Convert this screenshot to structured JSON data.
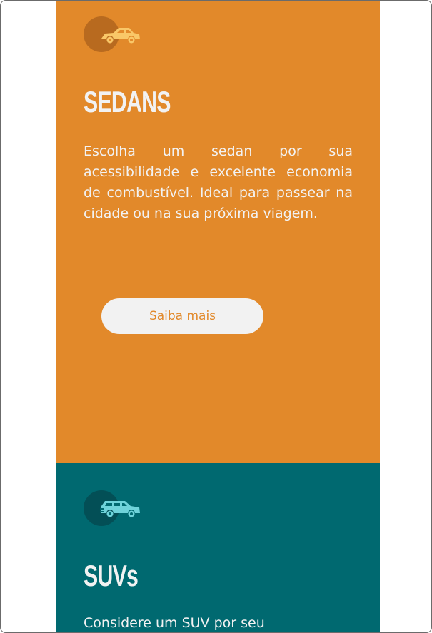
{
  "cards": [
    {
      "icon": "sedan-car-icon",
      "title": "SEDANS",
      "description": "Escolha um sedan por sua acessibilidade e excelente economia de combustível. Ideal para passear na cidade ou na sua próxima viagem.",
      "button_label": "Saiba mais",
      "bg_color": "#e2892a",
      "icon_color": "#f9c768"
    },
    {
      "icon": "suv-car-icon",
      "title": "SUVs",
      "description": "Considere um SUV por seu",
      "bg_color": "#006970",
      "icon_color": "#6fd3da"
    }
  ]
}
